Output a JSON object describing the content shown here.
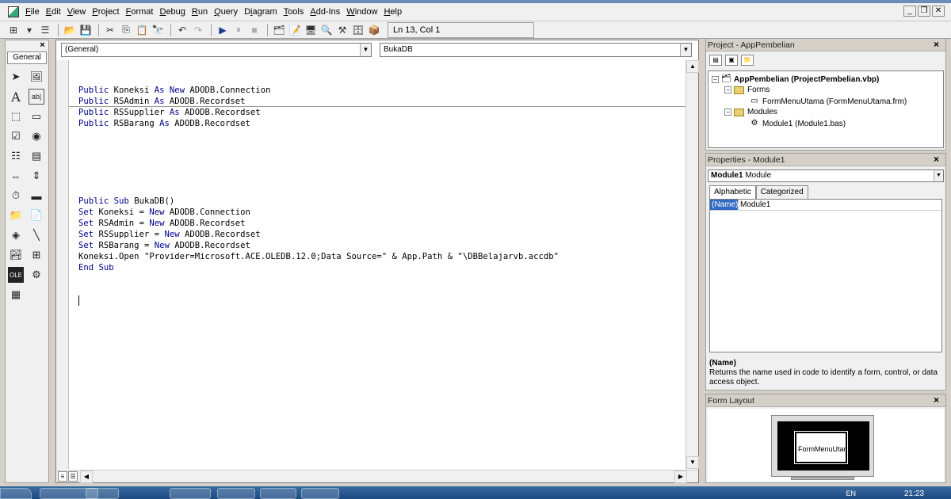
{
  "menu": {
    "items": [
      {
        "u": "F",
        "rest": "ile"
      },
      {
        "u": "E",
        "rest": "dit"
      },
      {
        "u": "V",
        "rest": "iew"
      },
      {
        "u": "P",
        "rest": "roject"
      },
      {
        "u": "F",
        "rest": "ormat",
        "pre": ""
      },
      {
        "u": "D",
        "rest": "ebug"
      },
      {
        "u": "R",
        "rest": "un"
      },
      {
        "u": "Q",
        "rest": "uery"
      },
      {
        "u": "i",
        "rest": "agram",
        "pre": "D"
      },
      {
        "u": "T",
        "rest": "ools"
      },
      {
        "u": "A",
        "rest": "dd-Ins"
      },
      {
        "u": "W",
        "rest": "indow"
      },
      {
        "u": "H",
        "rest": "elp"
      }
    ]
  },
  "toolbar": {
    "position": "Ln 13, Col 1"
  },
  "toolbox": {
    "tab": "General"
  },
  "code_window": {
    "object_combo": "(General)",
    "proc_combo": "BukaDB",
    "declarations": [
      "Public Koneksi As New ADODB.Connection",
      "Public RSAdmin As ADODB.Recordset",
      "Public RSSupplier As ADODB.Recordset",
      "Public RSBarang As ADODB.Recordset"
    ],
    "procedure": [
      "Public Sub BukaDB()",
      "Set Koneksi = New ADODB.Connection",
      "Set RSAdmin = New ADODB.Recordset",
      "Set RSSupplier = New ADODB.Recordset",
      "Set RSBarang = New ADODB.Recordset",
      "Koneksi.Open \"Provider=Microsoft.ACE.OLEDB.12.0;Data Source=\" & App.Path & \"\\DBBelajarvb.accdb\"",
      "End Sub"
    ]
  },
  "project": {
    "title": "Project - AppPembelian",
    "root": "AppPembelian (ProjectPembelian.vbp)",
    "forms_folder": "Forms",
    "form_item": "FormMenuUtama (FormMenuUtama.frm)",
    "modules_folder": "Modules",
    "module_item": "Module1 (Module1.bas)"
  },
  "properties": {
    "title": "Properties - Module1",
    "object_name": "Module1",
    "object_type": "Module",
    "tab_alphabetic": "Alphabetic",
    "tab_categorized": "Categorized",
    "prop_name": "(Name)",
    "prop_value": "Module1",
    "desc_title": "(Name)",
    "desc_text": "Returns the name used in code to identify a form, control, or data access object."
  },
  "form_layout": {
    "title": "Form Layout",
    "form_label": "FormMenuUtama"
  },
  "taskbar": {
    "lang": "EN",
    "clock": "21:23"
  }
}
